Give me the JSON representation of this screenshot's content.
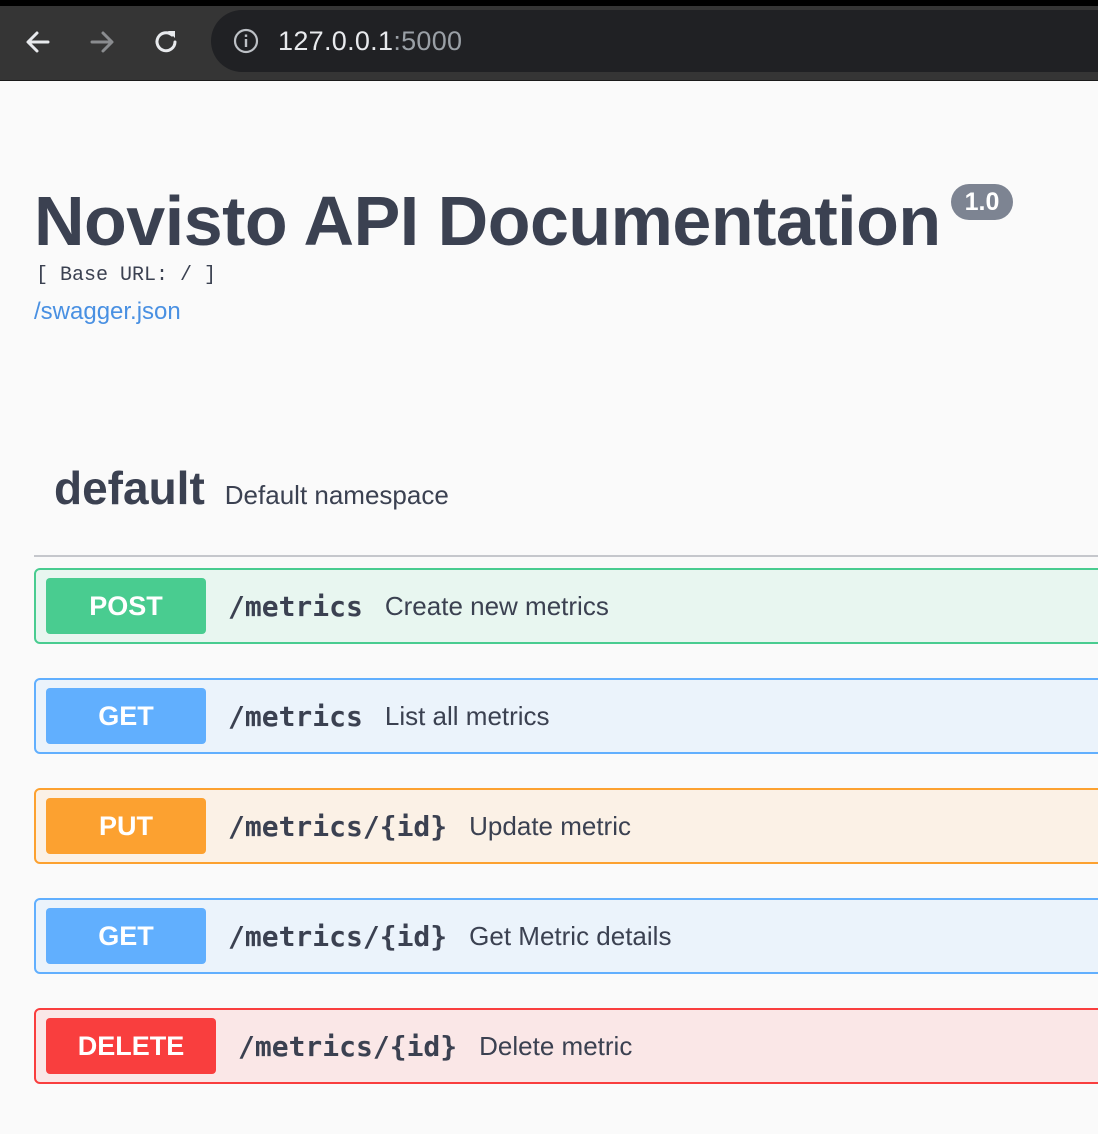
{
  "browser": {
    "back_icon": "arrow-left-icon",
    "forward_icon": "arrow-right-icon",
    "reload_icon": "reload-icon",
    "info_icon": "info-circle-icon",
    "url_host": "127.0.0.1",
    "url_port": ":5000"
  },
  "header": {
    "title": "Novisto API Documentation",
    "version": "1.0",
    "base_url": "[ Base URL: / ]",
    "spec_link": "/swagger.json"
  },
  "tag": {
    "name": "default",
    "description": "Default namespace"
  },
  "operations": [
    {
      "method": "POST",
      "path": "/metrics",
      "summary": "Create new metrics",
      "color": "#49cc90",
      "bg": "#e8f6f0",
      "border": "#49cc90"
    },
    {
      "method": "GET",
      "path": "/metrics",
      "summary": "List all metrics",
      "color": "#61affe",
      "bg": "#ebf3fb",
      "border": "#61affe"
    },
    {
      "method": "PUT",
      "path": "/metrics/{id}",
      "summary": "Update metric",
      "color": "#fca130",
      "bg": "#fbf1e6",
      "border": "#fca130"
    },
    {
      "method": "GET",
      "path": "/metrics/{id}",
      "summary": "Get Metric details",
      "color": "#61affe",
      "bg": "#ebf3fb",
      "border": "#61affe"
    },
    {
      "method": "DELETE",
      "path": "/metrics/{id}",
      "summary": "Delete metric",
      "color": "#f93e3e",
      "bg": "#fae7e7",
      "border": "#f93e3e"
    }
  ]
}
